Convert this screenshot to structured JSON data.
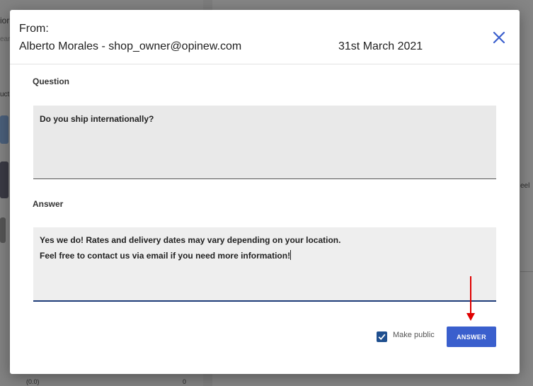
{
  "background": {
    "snippets": [
      "ior",
      "ear",
      "uct",
      "eel",
      "(0.0)",
      "0"
    ]
  },
  "modal": {
    "from_label": "From:",
    "sender": "Alberto Morales - shop_owner@opinew.com",
    "date": "31st March 2021",
    "close_icon": "close-icon",
    "question_label": "Question",
    "question_text": "Do you ship internationally?",
    "answer_label": "Answer",
    "answer_text": "Yes we do! Rates and delivery dates may vary depending on your location.\nFeel free to contact us via email if you need more information!",
    "make_public_label": "Make public",
    "make_public_checked": true,
    "answer_button": "ANSWER"
  },
  "colors": {
    "accent": "#3a5fcd",
    "close_icon": "#3a5fcd",
    "checkbox": "#1f4f8f",
    "annotation_arrow": "#e00000"
  }
}
